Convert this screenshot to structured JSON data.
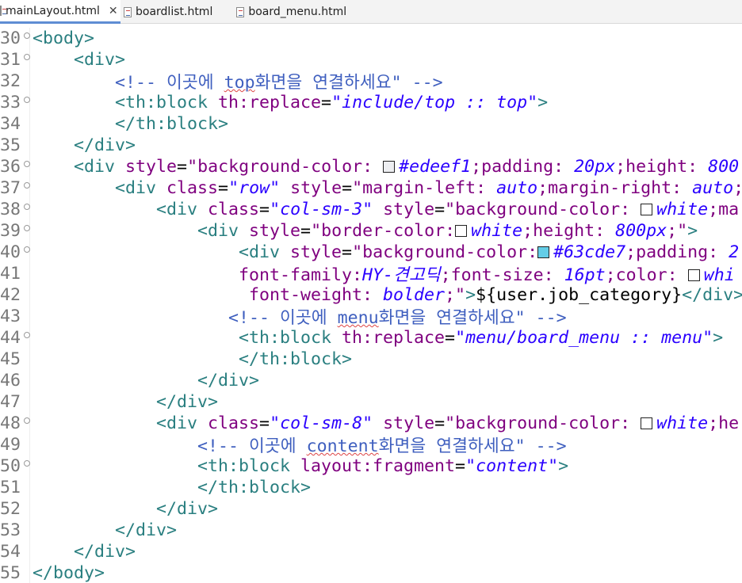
{
  "tabs": [
    {
      "label": "mainLayout.html",
      "active": true,
      "closable": true
    },
    {
      "label": "boardlist.html",
      "active": false
    },
    {
      "label": "board_menu.html",
      "active": false
    }
  ],
  "colors": {
    "tag": "#2a7f80",
    "attribute": "#7f007f",
    "value": "#2a00ff",
    "comment": "#3f5fbf"
  },
  "editor": {
    "lines": [
      {
        "n": "30",
        "fold": true,
        "tokens": [
          [
            "t",
            "<body>"
          ]
        ]
      },
      {
        "n": "31",
        "fold": true,
        "tokens": [
          [
            "p",
            "    "
          ],
          [
            "t",
            "<div>"
          ]
        ]
      },
      {
        "n": "32",
        "fold": false,
        "tokens": [
          [
            "p",
            "        "
          ],
          [
            "c",
            "<!-- 이곳에 "
          ],
          [
            "cu",
            "top"
          ],
          [
            "c",
            "화면을 연결하세요\" -->"
          ]
        ]
      },
      {
        "n": "33",
        "fold": true,
        "tokens": [
          [
            "p",
            "        "
          ],
          [
            "t",
            "<th:block "
          ],
          [
            "a",
            "th:replace"
          ],
          [
            "p",
            "="
          ],
          [
            "v",
            "\"include/top :: top\""
          ],
          [
            "t",
            ">"
          ]
        ]
      },
      {
        "n": "34",
        "fold": false,
        "tokens": [
          [
            "p",
            "        "
          ],
          [
            "t",
            "</th:block>"
          ]
        ]
      },
      {
        "n": "35",
        "fold": false,
        "tokens": [
          [
            "p",
            "    "
          ],
          [
            "t",
            "</div>"
          ]
        ]
      },
      {
        "n": "36",
        "fold": true,
        "tokens": [
          [
            "p",
            "    "
          ],
          [
            "t",
            "<div "
          ],
          [
            "a",
            "style"
          ],
          [
            "p",
            "="
          ],
          [
            "a",
            "\"background-color: "
          ],
          [
            "s",
            "#edeef1"
          ],
          [
            "v",
            "#edeef1"
          ],
          [
            "a",
            ";padding: "
          ],
          [
            "v",
            "20px"
          ],
          [
            "a",
            ";height: "
          ],
          [
            "v",
            "800"
          ]
        ]
      },
      {
        "n": "37",
        "fold": true,
        "tokens": [
          [
            "p",
            "        "
          ],
          [
            "t",
            "<div "
          ],
          [
            "a",
            "class"
          ],
          [
            "p",
            "="
          ],
          [
            "v",
            "\"row\""
          ],
          [
            "a",
            " style"
          ],
          [
            "p",
            "="
          ],
          [
            "a",
            "\"margin-left: "
          ],
          [
            "v",
            "auto"
          ],
          [
            "a",
            ";margin-right: "
          ],
          [
            "v",
            "auto"
          ],
          [
            "a",
            ";"
          ]
        ]
      },
      {
        "n": "38",
        "fold": true,
        "tokens": [
          [
            "p",
            "            "
          ],
          [
            "t",
            "<div "
          ],
          [
            "a",
            "class"
          ],
          [
            "p",
            "="
          ],
          [
            "v",
            "\"col-sm-3\""
          ],
          [
            "a",
            " style"
          ],
          [
            "p",
            "="
          ],
          [
            "a",
            "\"background-color: "
          ],
          [
            "s",
            "#ffffff"
          ],
          [
            "v",
            "white"
          ],
          [
            "a",
            ";ma"
          ]
        ]
      },
      {
        "n": "39",
        "fold": true,
        "tokens": [
          [
            "p",
            "                "
          ],
          [
            "t",
            "<div "
          ],
          [
            "a",
            "style"
          ],
          [
            "p",
            "="
          ],
          [
            "a",
            "\"border-color:"
          ],
          [
            "s",
            "#ffffff"
          ],
          [
            "v",
            "white"
          ],
          [
            "a",
            ";height: "
          ],
          [
            "v",
            "800px"
          ],
          [
            "a",
            ";\""
          ],
          [
            "t",
            ">"
          ]
        ]
      },
      {
        "n": "40",
        "fold": true,
        "tokens": [
          [
            "p",
            "                    "
          ],
          [
            "t",
            "<div "
          ],
          [
            "a",
            "style"
          ],
          [
            "p",
            "="
          ],
          [
            "a",
            "\"background-color:"
          ],
          [
            "s",
            "#63cde7"
          ],
          [
            "v",
            "#63cde7"
          ],
          [
            "a",
            ";padding: "
          ],
          [
            "v",
            "2"
          ]
        ]
      },
      {
        "n": "41",
        "fold": false,
        "tokens": [
          [
            "p",
            "                    "
          ],
          [
            "a",
            "font-family:"
          ],
          [
            "v",
            "HY-견고딕"
          ],
          [
            "a",
            ";font-size: "
          ],
          [
            "v",
            "16pt"
          ],
          [
            "a",
            ";color: "
          ],
          [
            "s",
            "#ffffff"
          ],
          [
            "v",
            "whi"
          ]
        ]
      },
      {
        "n": "42",
        "fold": false,
        "tokens": [
          [
            "p",
            "                     "
          ],
          [
            "a",
            "font-weight: "
          ],
          [
            "v",
            "bolder"
          ],
          [
            "a",
            ";\""
          ],
          [
            "t",
            ">"
          ],
          [
            "p",
            "${user.job_category}"
          ],
          [
            "t",
            "</div>"
          ]
        ]
      },
      {
        "n": "43",
        "fold": false,
        "tokens": [
          [
            "p",
            "                   "
          ],
          [
            "c",
            "<!-- 이곳에 "
          ],
          [
            "cu",
            "menu"
          ],
          [
            "c",
            "화면을 연결하세요\" -->"
          ]
        ]
      },
      {
        "n": "44",
        "fold": true,
        "tokens": [
          [
            "p",
            "                    "
          ],
          [
            "t",
            "<th:block "
          ],
          [
            "a",
            "th:replace"
          ],
          [
            "p",
            "="
          ],
          [
            "v",
            "\"menu/board_menu :: menu\""
          ],
          [
            "t",
            ">"
          ]
        ]
      },
      {
        "n": "45",
        "fold": false,
        "tokens": [
          [
            "p",
            "                    "
          ],
          [
            "t",
            "</th:block>"
          ]
        ]
      },
      {
        "n": "46",
        "fold": false,
        "tokens": [
          [
            "p",
            "                "
          ],
          [
            "t",
            "</div>"
          ]
        ]
      },
      {
        "n": "47",
        "fold": false,
        "tokens": [
          [
            "p",
            "            "
          ],
          [
            "t",
            "</div>"
          ]
        ]
      },
      {
        "n": "48",
        "fold": true,
        "tokens": [
          [
            "p",
            "            "
          ],
          [
            "t",
            "<div "
          ],
          [
            "a",
            "class"
          ],
          [
            "p",
            "="
          ],
          [
            "v",
            "\"col-sm-8\""
          ],
          [
            "a",
            " style"
          ],
          [
            "p",
            "="
          ],
          [
            "a",
            "\"background-color: "
          ],
          [
            "s",
            "#ffffff"
          ],
          [
            "v",
            "white"
          ],
          [
            "a",
            ";he"
          ]
        ]
      },
      {
        "n": "49",
        "fold": false,
        "tokens": [
          [
            "p",
            "                "
          ],
          [
            "c",
            "<!-- 이곳에 "
          ],
          [
            "cu",
            "content"
          ],
          [
            "c",
            "화면을 연결하세요\" -->"
          ]
        ]
      },
      {
        "n": "50",
        "fold": true,
        "tokens": [
          [
            "p",
            "                "
          ],
          [
            "t",
            "<th:block "
          ],
          [
            "a",
            "layout:fragment"
          ],
          [
            "p",
            "="
          ],
          [
            "v",
            "\"content\""
          ],
          [
            "t",
            ">"
          ]
        ]
      },
      {
        "n": "51",
        "fold": false,
        "tokens": [
          [
            "p",
            "                "
          ],
          [
            "t",
            "</th:block>"
          ]
        ]
      },
      {
        "n": "52",
        "fold": false,
        "tokens": [
          [
            "p",
            "            "
          ],
          [
            "t",
            "</div>"
          ]
        ]
      },
      {
        "n": "53",
        "fold": false,
        "tokens": [
          [
            "p",
            "        "
          ],
          [
            "t",
            "</div>"
          ]
        ]
      },
      {
        "n": "54",
        "fold": false,
        "tokens": [
          [
            "p",
            "    "
          ],
          [
            "t",
            "</div>"
          ]
        ]
      },
      {
        "n": "55",
        "fold": false,
        "tokens": [
          [
            "t",
            "</body>"
          ]
        ]
      }
    ]
  }
}
